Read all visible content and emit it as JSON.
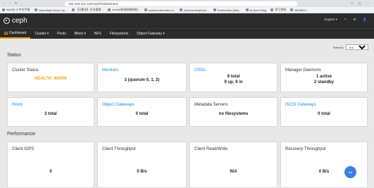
{
  "browser": {
    "url": "192.168.115.112/ceph/#/dashboard",
    "bookmarks": [
      "MySQL 8 中文手册",
      "OpenStack Docs: Op...",
      "【已解决】后台报错...",
      "Lechall资源获取网站...",
      "Install kubernetes w...",
      "[Kubernetes]Kube...",
      "Kubernetes (k8s)...",
      "Ai-Ace's Blog",
      "学习资料",
      "WEIMOS ..."
    ]
  },
  "ceph": {
    "logo": "ceph",
    "top_right": {
      "language": "English",
      "help": "?",
      "settings": "⚙",
      "user": "👤"
    },
    "nav": [
      {
        "label": "Dashboard",
        "active": true
      },
      {
        "label": "Cluster ▾"
      },
      {
        "label": "Pools"
      },
      {
        "label": "Block ▾"
      },
      {
        "label": "NFS"
      },
      {
        "label": "Filesystems"
      },
      {
        "label": "Object Gateway ▾"
      }
    ]
  },
  "status": {
    "title": "Status",
    "refresh_label": "Refresh:",
    "refresh_value": "5 s",
    "cards": [
      {
        "title": "Cluster Status",
        "value": "HEALTH_WARN"
      },
      {
        "title": "Monitors",
        "value": "3 (quorum 0, 1, 2)"
      },
      {
        "title": "OSDs",
        "line1": "9 total",
        "line2": "9 up, 9 in"
      },
      {
        "title": "Manager Daemons",
        "line1": "1 active",
        "line2": "2 standby"
      },
      {
        "title": "Hosts",
        "value": "3 total"
      },
      {
        "title": "Object Gateways",
        "value": "0 total"
      },
      {
        "title": "Metadata Servers",
        "value": "no filesystems"
      },
      {
        "title": "iSCSI Gateways",
        "value": "0 total"
      }
    ]
  },
  "performance": {
    "title": "Performance",
    "cards": [
      {
        "title": "Client IOPS",
        "value": "0"
      },
      {
        "title": "Client Throughput",
        "value": "0 B/s"
      },
      {
        "title": "Client Read/Write",
        "value": "N/A"
      },
      {
        "title": "Recovery Throughput",
        "value": "0 B/s"
      }
    ]
  },
  "colors": {
    "accent": "#f3a00e",
    "link": "#1b8bd8",
    "warn": "#f2a21c",
    "nav_bg": "#2b2b2b"
  }
}
